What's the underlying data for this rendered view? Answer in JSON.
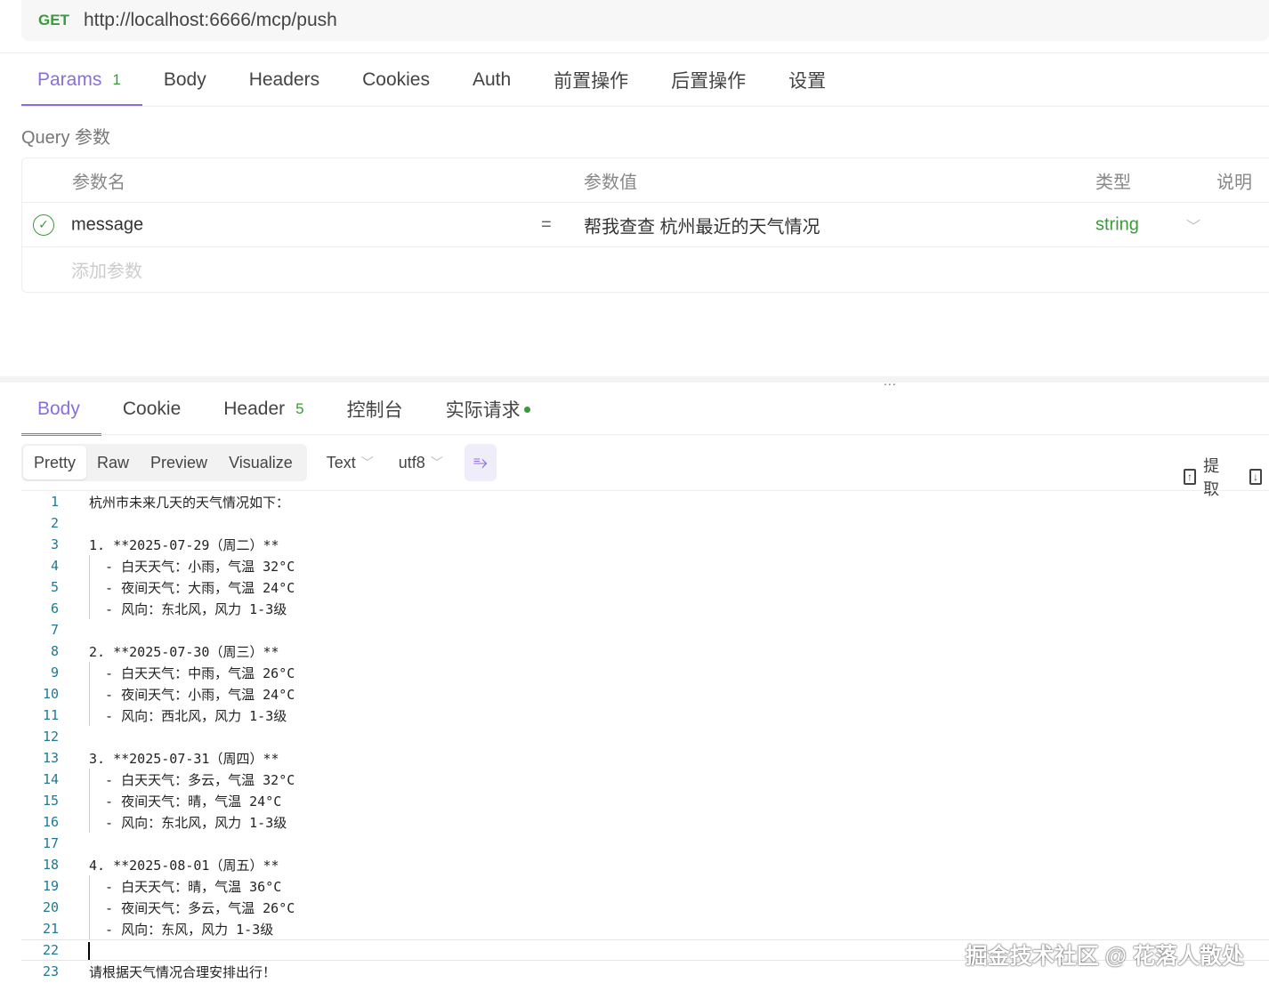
{
  "request": {
    "method": "GET",
    "url": "http://localhost:6666/mcp/push"
  },
  "req_tabs": [
    {
      "label": "Params",
      "badge": "1"
    },
    {
      "label": "Body"
    },
    {
      "label": "Headers"
    },
    {
      "label": "Cookies"
    },
    {
      "label": "Auth"
    },
    {
      "label": "前置操作"
    },
    {
      "label": "后置操作"
    },
    {
      "label": "设置"
    }
  ],
  "query": {
    "title": "Query 参数",
    "headers": {
      "name": "参数名",
      "value": "参数值",
      "type": "类型",
      "desc": "说明"
    },
    "row": {
      "name": "message",
      "eq": "=",
      "value": "帮我查查 杭州最近的天气情况",
      "type": "string"
    },
    "add_placeholder": "添加参数"
  },
  "divider_handle": "...",
  "resp_tabs": [
    {
      "label": "Body"
    },
    {
      "label": "Cookie"
    },
    {
      "label": "Header",
      "badge": "5"
    },
    {
      "label": "控制台"
    },
    {
      "label": "实际请求"
    }
  ],
  "view_modes": [
    "Pretty",
    "Raw",
    "Preview",
    "Visualize"
  ],
  "format": "Text",
  "encoding": "utf8",
  "extract_label": "提取",
  "code_lines": [
    "杭州市未来几天的天气情况如下：",
    "",
    "1. **2025-07-29（周二）**",
    "  - 白天天气：小雨，气温 32°C",
    "  - 夜间天气：大雨，气温 24°C",
    "  - 风向：东北风，风力 1-3级",
    "",
    "2. **2025-07-30（周三）**",
    "  - 白天天气：中雨，气温 26°C",
    "  - 夜间天气：小雨，气温 24°C",
    "  - 风向：西北风，风力 1-3级",
    "",
    "3. **2025-07-31（周四）**",
    "  - 白天天气：多云，气温 32°C",
    "  - 夜间天气：晴，气温 24°C",
    "  - 风向：东北风，风力 1-3级",
    "",
    "4. **2025-08-01（周五）**",
    "  - 白天天气：晴，气温 36°C",
    "  - 夜间天气：多云，气温 26°C",
    "  - 风向：东风，风力 1-3级",
    "",
    "请根据天气情况合理安排出行！"
  ],
  "watermark": "掘金技术社区 @ 花落人散处",
  "colors": {
    "accent": "#8a6fdc",
    "green": "#3a9a3a"
  }
}
